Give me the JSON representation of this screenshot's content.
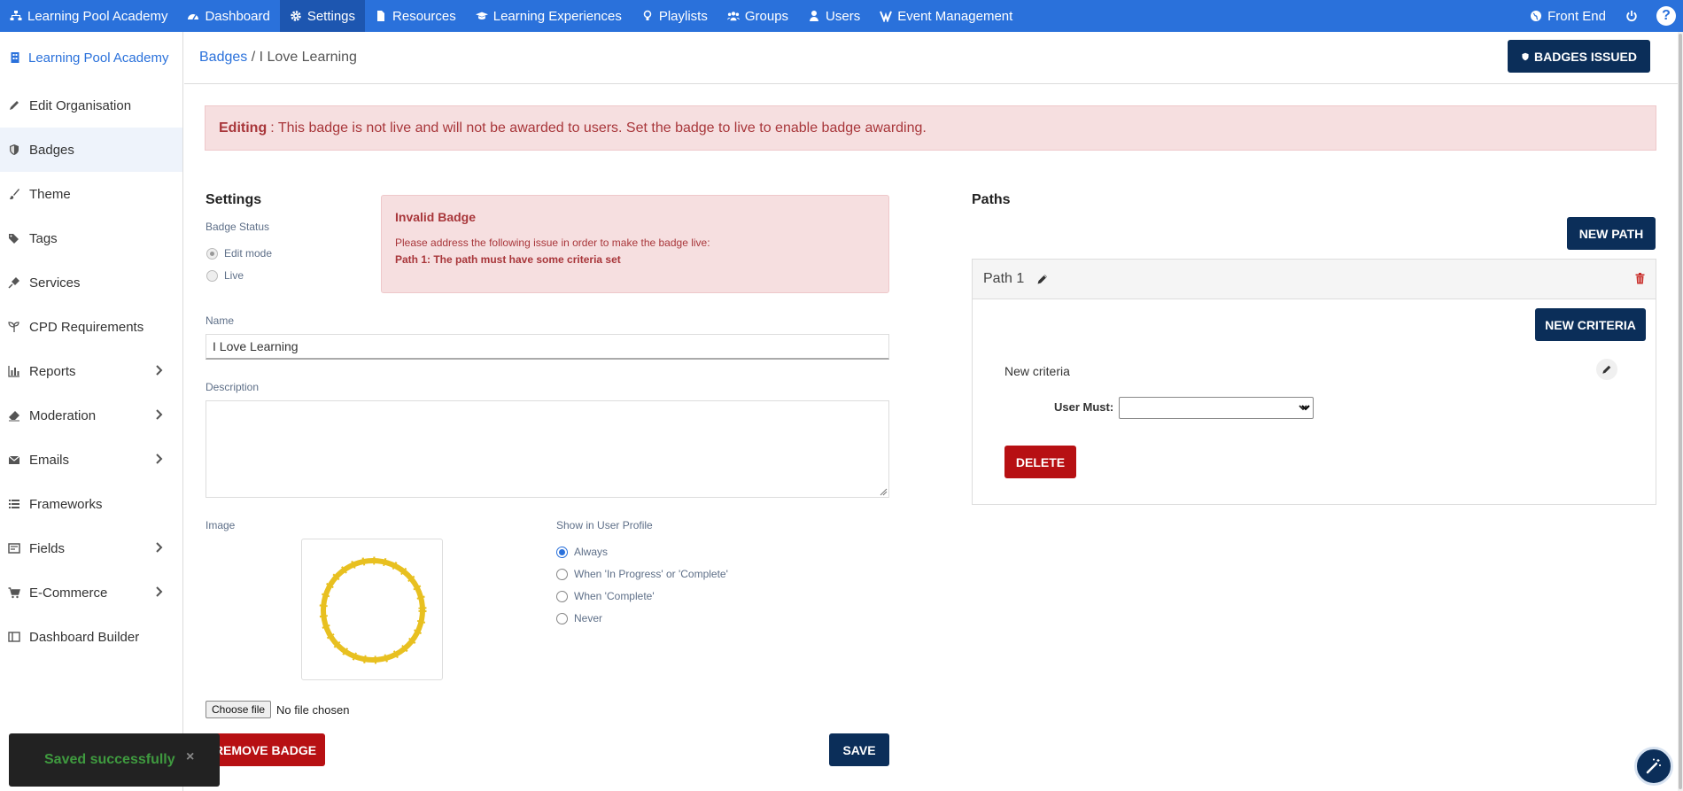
{
  "topnav": {
    "items": [
      {
        "label": "Learning Pool Academy",
        "icon": "sitemap-icon"
      },
      {
        "label": "Dashboard",
        "icon": "tachometer-icon"
      },
      {
        "label": "Settings",
        "icon": "gear-icon",
        "active": true
      },
      {
        "label": "Resources",
        "icon": "file-icon"
      },
      {
        "label": "Learning Experiences",
        "icon": "graduation-cap-icon"
      },
      {
        "label": "Playlists",
        "icon": "lightbulb-icon"
      },
      {
        "label": "Groups",
        "icon": "users-icon"
      },
      {
        "label": "Users",
        "icon": "user-icon"
      },
      {
        "label": "Event Management",
        "icon": "event-icon"
      }
    ],
    "front_end": "Front End",
    "help": "?"
  },
  "sidebar": {
    "org": "Learning Pool Academy",
    "items": [
      {
        "label": "Edit Organisation",
        "icon": "pencil-icon"
      },
      {
        "label": "Badges",
        "icon": "shield-icon",
        "active": true
      },
      {
        "label": "Theme",
        "icon": "brush-icon"
      },
      {
        "label": "Tags",
        "icon": "tags-icon"
      },
      {
        "label": "Services",
        "icon": "plug-icon"
      },
      {
        "label": "CPD Requirements",
        "icon": "seedling-icon"
      },
      {
        "label": "Reports",
        "icon": "bar-chart-icon",
        "expandable": true
      },
      {
        "label": "Moderation",
        "icon": "eraser-icon",
        "expandable": true
      },
      {
        "label": "Emails",
        "icon": "envelope-icon",
        "expandable": true
      },
      {
        "label": "Frameworks",
        "icon": "list-icon"
      },
      {
        "label": "Fields",
        "icon": "field-icon",
        "expandable": true
      },
      {
        "label": "E-Commerce",
        "icon": "cart-icon",
        "expandable": true
      },
      {
        "label": "Dashboard Builder",
        "icon": "columns-icon"
      }
    ]
  },
  "header": {
    "breadcrumb_link": "Badges",
    "breadcrumb_sep": "/",
    "breadcrumb_current": "I Love Learning",
    "badges_issued": "BADGES ISSUED"
  },
  "alert": {
    "strong": "Editing",
    "text": ": This badge is not live and will not be awarded to users. Set the badge to live to enable badge awarding."
  },
  "settings": {
    "heading": "Settings",
    "badge_status_label": "Badge Status",
    "status_options": [
      "Edit mode",
      "Live"
    ],
    "invalid": {
      "title": "Invalid Badge",
      "message": "Please address the following issue in order to make the badge live:",
      "issue": "Path 1: The path must have some criteria set"
    },
    "name_label": "Name",
    "name_value": "I Love Learning",
    "description_label": "Description",
    "description_value": "",
    "image_label": "Image",
    "profile_label": "Show in User Profile",
    "profile_options": [
      "Always",
      "When 'In Progress' or 'Complete'",
      "When 'Complete'",
      "Never"
    ],
    "profile_selected": "Always",
    "file_button": "Choose file",
    "file_status": "No file chosen",
    "remove_badge": "REMOVE BADGE",
    "save": "SAVE"
  },
  "toast": {
    "text": "Saved successfully",
    "close": "×"
  },
  "paths": {
    "heading": "Paths",
    "new_path": "NEW PATH",
    "path_title": "Path 1",
    "new_criteria": "NEW CRITERIA",
    "criteria_label": "New criteria",
    "user_must_label": "User Must:",
    "user_must_value": "",
    "delete": "DELETE"
  },
  "colors": {
    "topnav": "#2a71db",
    "dark_button": "#0b2e59",
    "danger": "#b71013",
    "alert_bg": "#f6dfe0",
    "badge_ring": "#e8c020"
  }
}
